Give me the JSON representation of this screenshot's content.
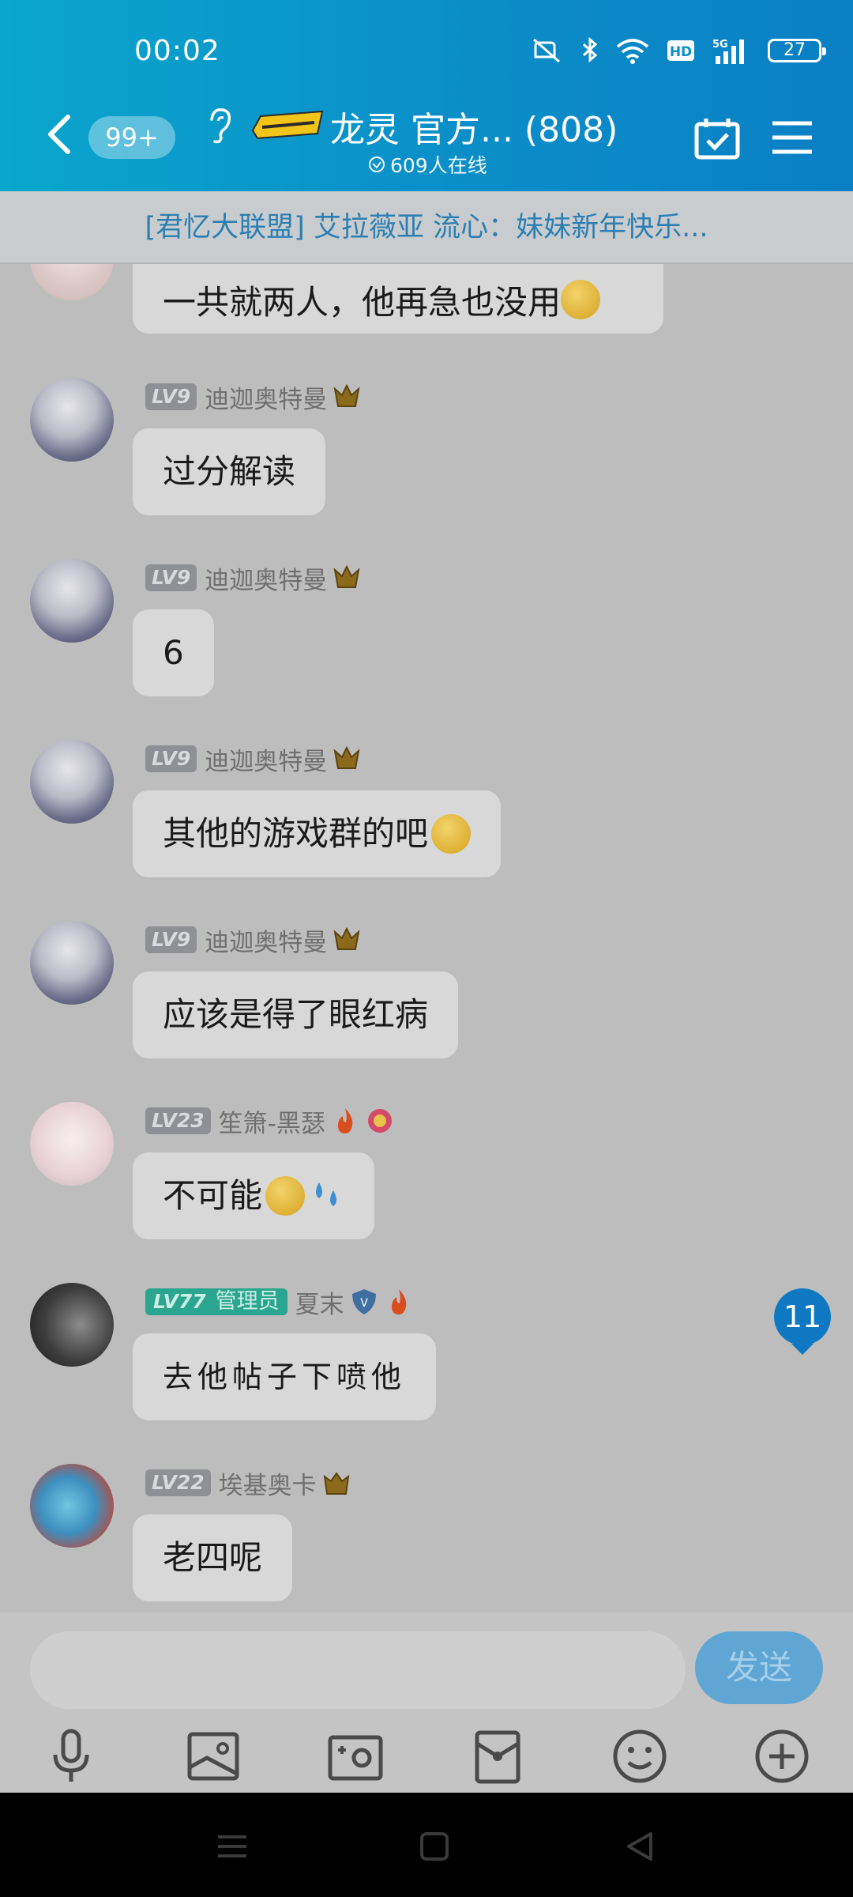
{
  "status_bar": {
    "time": "00:02",
    "battery": "27"
  },
  "header": {
    "unread": "99+",
    "title": "龙灵 官方... (808)",
    "online": "609人在线"
  },
  "announcement": "[君忆大联盟] 艾拉薇亚 流心：妹妹新年快乐...",
  "top_message": {
    "text": "一共就两人，他再急也没用"
  },
  "messages": [
    {
      "level": "LV9",
      "nick": "迪迦奥特曼",
      "text": "过分解读"
    },
    {
      "level": "LV9",
      "nick": "迪迦奥特曼",
      "text": "6"
    },
    {
      "level": "LV9",
      "nick": "迪迦奥特曼",
      "text": "其他的游戏群的吧"
    },
    {
      "level": "LV9",
      "nick": "迪迦奥特曼",
      "text": "应该是得了眼红病"
    },
    {
      "level": "LV23",
      "nick": "笙箫-黑瑟",
      "text": "不可能"
    },
    {
      "level": "LV77",
      "role": "管理员",
      "nick": "夏末",
      "text": "去他帖子下喷他"
    },
    {
      "level": "LV22",
      "nick": "埃基奥卡",
      "text": "老四呢"
    }
  ],
  "new_message_count": "11",
  "input": {
    "send_label": "发送"
  },
  "toolbar_icons": [
    "microphone-icon",
    "image-icon",
    "camera-icon",
    "red-packet-icon",
    "emoji-icon",
    "plus-icon"
  ],
  "colors": {
    "header": "#0b90c9",
    "accent": "#0e79c2",
    "admin_badge": "#2aa58f"
  }
}
